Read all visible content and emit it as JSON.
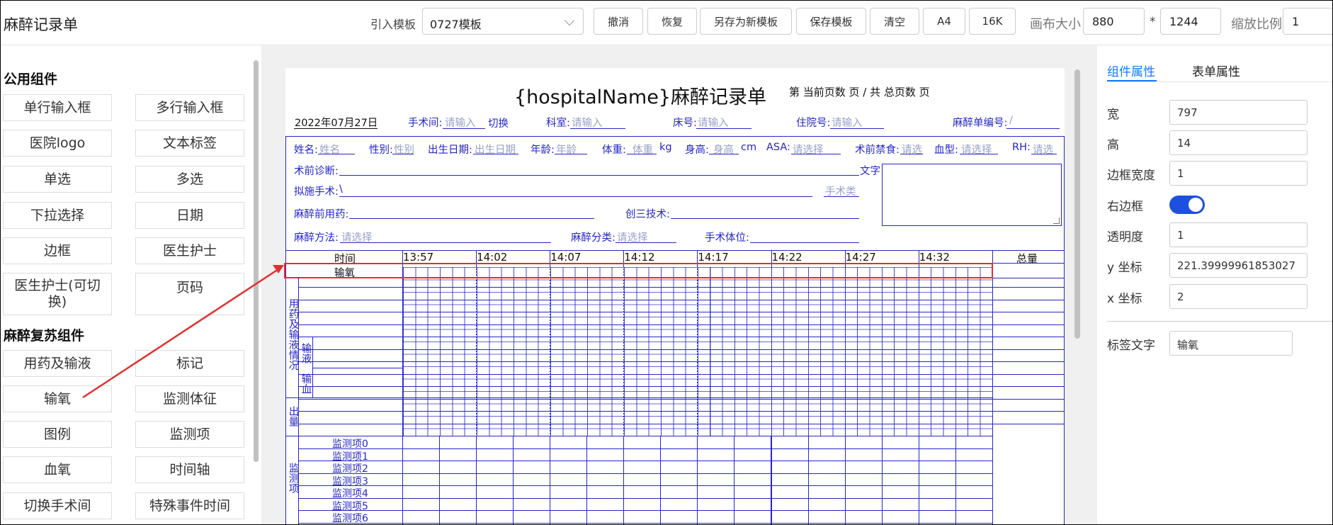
{
  "toolbar": {
    "app_title": "麻醉记录单",
    "template_label": "引入模板",
    "template_value": "0727模板",
    "undo": "撤消",
    "redo": "恢复",
    "save_as_new": "另存为新模板",
    "save_template": "保存模板",
    "clear": "清空",
    "a4": "A4",
    "k16": "16K",
    "canvas_size_label": "画布大小",
    "canvas_width": "880",
    "times": "*",
    "canvas_height": "1244",
    "zoom_label": "缩放比例",
    "zoom_value": "1"
  },
  "left_panel": {
    "public_title": "公用组件",
    "public_items": [
      "单行输入框",
      "多行输入框",
      "医院logo",
      "文本标签",
      "单选",
      "多选",
      "下拉选择",
      "日期",
      "边框",
      "医生护士",
      "医生护士(可切换)",
      "页码"
    ],
    "anes_title": "麻醉复苏组件",
    "anes_items": [
      "用药及输液",
      "标记",
      "输氧",
      "监测体征",
      "图例",
      "监测项",
      "血氧",
      "时间轴",
      "切换手术间",
      "特殊事件时间"
    ]
  },
  "form": {
    "title": "{hospitalName}麻醉记录单",
    "page_info": "第 当前页数 页 / 共 总页数 页",
    "date": "2022年07月27日",
    "row1": {
      "or_label": "手术间:",
      "or_ph": "请输入",
      "switch": "切换",
      "dept_label": "科室:",
      "dept_ph": "请输入",
      "bed_label": "床号:",
      "bed_ph": "请输入",
      "inpatient_label": "住院号:",
      "inpatient_ph": "请输入",
      "sheet_no_label": "麻醉单编号:",
      "sheet_no_val": "/"
    },
    "row2": {
      "name_label": "姓名:",
      "name_ph": "姓名",
      "gender_label": "性别:",
      "gender_ph": "性别",
      "dob_label": "出生日期:",
      "dob_ph": "出生日期",
      "age_label": "年龄:",
      "age_ph": "年龄",
      "weight_label": "体重:",
      "weight_ph": "体重",
      "weight_unit": "kg",
      "height_label": "身高:",
      "height_ph": "身高",
      "height_unit": "cm",
      "asa_label": "ASA:",
      "asa_ph": "请选择",
      "fasting_label": "术前禁食:",
      "fasting_ph": "请选",
      "blood_label": "血型:",
      "blood_ph": "请选择",
      "rh_label": "RH:",
      "rh_ph": "请选"
    },
    "preop_diag_label": "术前诊断:",
    "text_label": "文字",
    "planned_surgery_label": "拟施手术:",
    "planned_surgery_val": "\\",
    "surgery_type_ph": "手术类",
    "premed_label": "麻醉前用药:",
    "invasive_label": "创三技术:",
    "anes_method_label": "麻醉方法:",
    "anes_method_ph": "请选择",
    "anes_class_label": "麻醉分类:",
    "anes_class_ph": "请选择",
    "position_label": "手术体位:",
    "grid": {
      "time_label": "时间",
      "times": [
        "13:57",
        "14:02",
        "14:07",
        "14:12",
        "14:17",
        "14:22",
        "14:27",
        "14:32"
      ],
      "total_label": "总量",
      "oxygen_label": "输氧",
      "meds_label": "用药及输液情况",
      "infusion_label": "输液",
      "blood_label": "输血",
      "output_label": "出量",
      "monitor_label": "监测项",
      "monitor_items": [
        "监测项0",
        "监测项1",
        "监测项2",
        "监测项3",
        "监测项4",
        "监测项5",
        "监测项6"
      ]
    }
  },
  "right_panel": {
    "tab_component": "组件属性",
    "tab_form": "表单属性",
    "width_label": "宽",
    "width_val": "797",
    "height_label": "高",
    "height_val": "14",
    "border_width_label": "边框宽度",
    "border_width_val": "1",
    "right_border_label": "右边框",
    "right_border_on": true,
    "opacity_label": "透明度",
    "opacity_val": "1",
    "y_label": "y 坐标",
    "y_val": "221.39999961853027",
    "x_label": "x 坐标",
    "x_val": "2",
    "label_text_label": "标签文字",
    "label_text_val": "输氧"
  },
  "colors": {
    "accent": "#1677ff",
    "form_blue": "#2626c8",
    "highlight": "#e03030",
    "toggle": "#1d4fe0"
  }
}
